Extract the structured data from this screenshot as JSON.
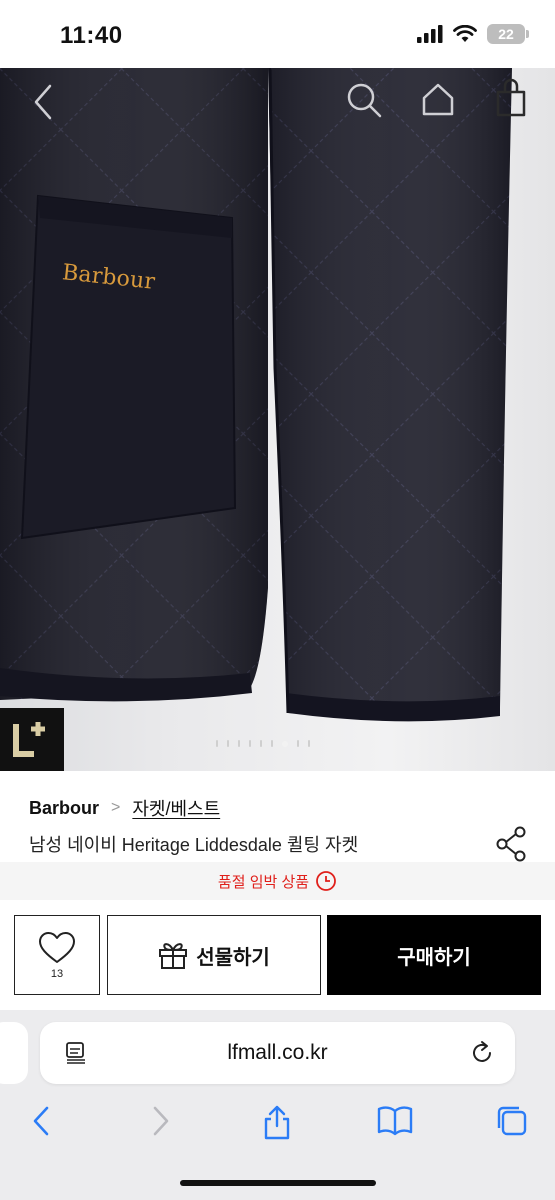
{
  "status_bar": {
    "time": "11:40",
    "battery": "22"
  },
  "hero": {
    "logo_text": "Barbour",
    "badge": "L+",
    "carousel": {
      "total": 9,
      "active_index": 6
    }
  },
  "product": {
    "brand": "Barbour",
    "breadcrumb_separator": ">",
    "category": "자켓/베스트",
    "title": "남성 네이비 Heritage Liddesdale 퀼팅 자켓"
  },
  "notice": {
    "text": "품절 임박 상품",
    "color": "#e0201b"
  },
  "actions": {
    "like_count": "13",
    "gift_label": "선물하기",
    "buy_label": "구매하기"
  },
  "browser": {
    "url": "lfmall.co.kr"
  },
  "colors": {
    "accent": "#e0201b",
    "jacket": "#1f1f2a",
    "buy_button": "#000000"
  }
}
